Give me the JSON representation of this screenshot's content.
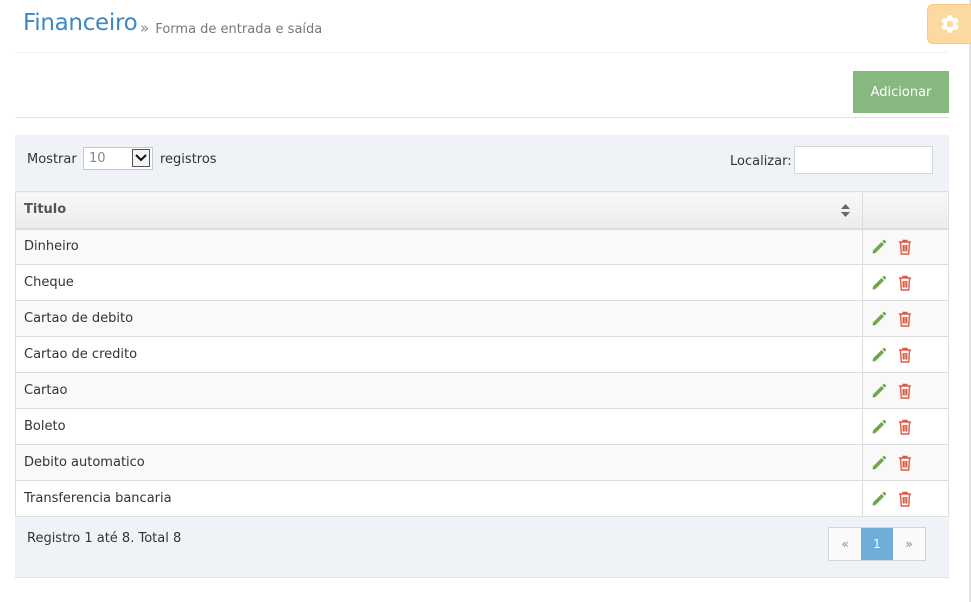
{
  "header": {
    "title": "Financeiro",
    "subtitle_sep": "»",
    "subtitle": "Forma de entrada e saída"
  },
  "settings": {
    "icon": "gear-icon",
    "color": "#fbd9a1"
  },
  "toolbar": {
    "add_label": "Adicionar",
    "add_color": "#87b87f"
  },
  "table_controls": {
    "show_label": "Mostrar",
    "page_length": "10",
    "records_label": "registros",
    "search_label": "Localizar:",
    "search_value": ""
  },
  "table": {
    "columns": [
      "Titulo",
      ""
    ],
    "rows": [
      "Dinheiro",
      "Cheque",
      "Cartao de debito",
      "Cartao de credito",
      "Cartao",
      "Boleto",
      "Debito automatico",
      "Transferencia bancaria"
    ],
    "row_actions": [
      "pencil-icon",
      "trash-icon"
    ]
  },
  "footer": {
    "info": "Registro 1 até 8. Total 8",
    "pagination": {
      "prev": "«",
      "current": "1",
      "next": "»"
    }
  },
  "colors": {
    "accent": "#3e88c4",
    "edit": "#69aa46",
    "delete": "#dd5a43",
    "pager_active": "#6faed9"
  }
}
